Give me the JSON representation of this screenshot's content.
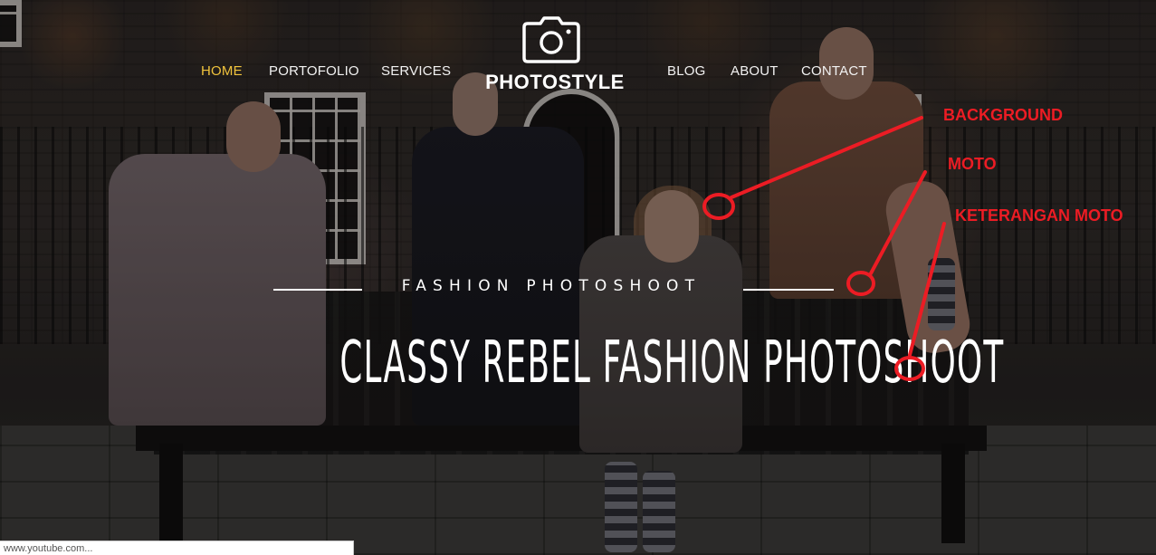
{
  "nav": {
    "left": [
      "HOME",
      "PORTOFOLIO",
      "SERVICES"
    ],
    "right": [
      "BLOG",
      "ABOUT",
      "CONTACT"
    ],
    "active": "HOME",
    "active_color": "#f0c33c"
  },
  "logo": {
    "icon": "camera-icon",
    "text": "PHOTOSTYLE"
  },
  "hero": {
    "moto": "FASHION PHOTOSHOOT",
    "moto_description": "CLASSY REBEL FASHION PHOTOSHOOT"
  },
  "annotations": {
    "color": "#ec1c24",
    "background": "BACKGROUND",
    "moto": "MOTO",
    "moto_description": "KETERANGAN MOTO"
  },
  "status_bar": {
    "url": "www.youtube.com..."
  }
}
